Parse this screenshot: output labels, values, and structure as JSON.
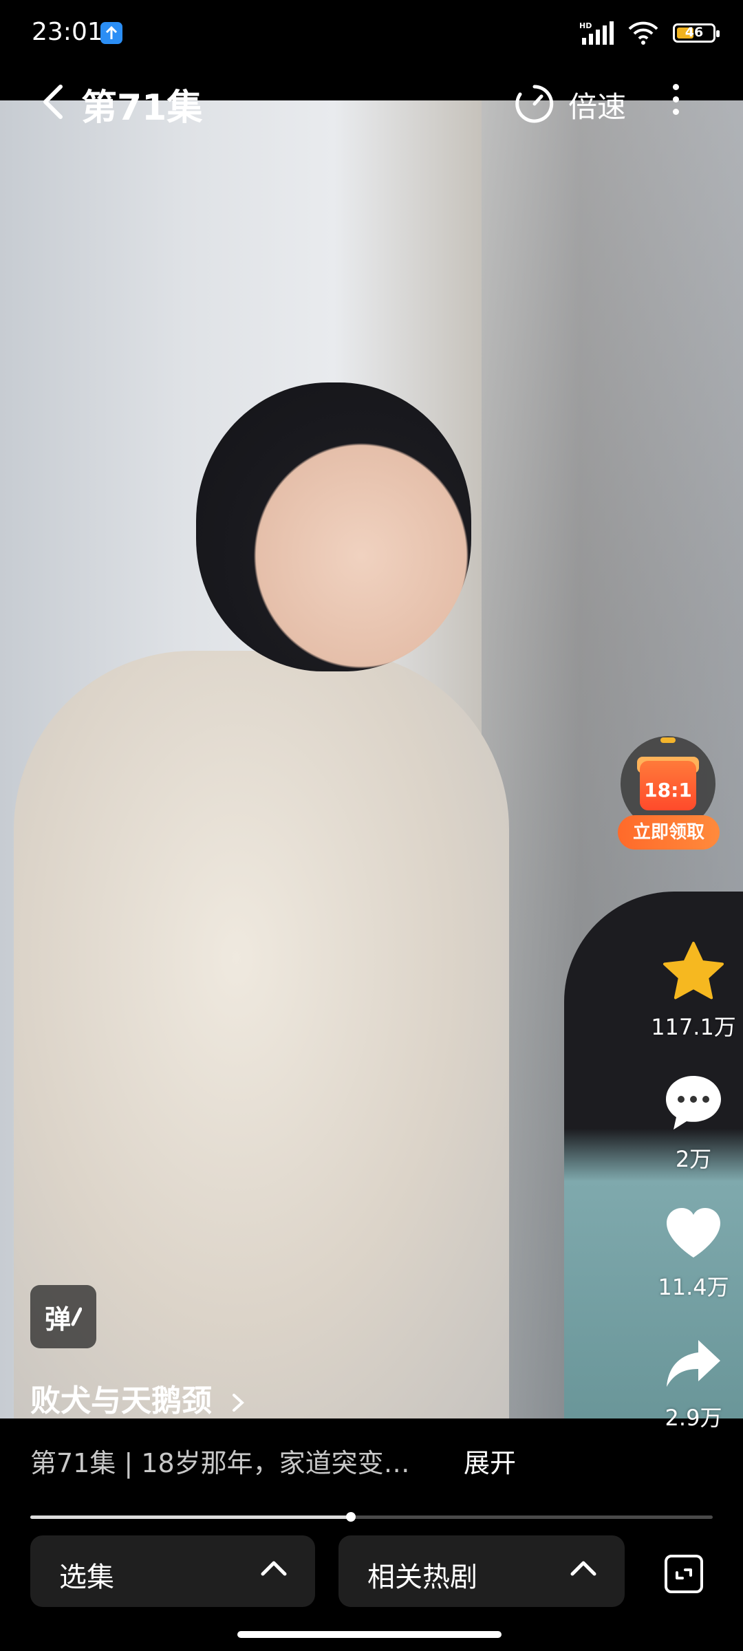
{
  "status_bar": {
    "time": "23:01",
    "hd": "HD",
    "battery": "46"
  },
  "nav": {
    "title": "第71集",
    "speed_label": "倍速"
  },
  "reward": {
    "box_text": "18:1",
    "button_label": "立即领取"
  },
  "actions": {
    "favorite_count": "117.1万",
    "comment_count": "2万",
    "like_count": "11.4万",
    "share_count": "2.9万"
  },
  "danmaku_label": "弹",
  "series_title": "败犬与天鹅颈",
  "description": "第71集 | 18岁那年，家道突变…",
  "expand_label": "展开",
  "progress": {
    "played_fraction": 0.47
  },
  "bottom": {
    "episodes_label": "选集",
    "related_label": "相关热剧"
  },
  "colors": {
    "accent_orange": "#ff6a2a",
    "star_yellow": "#f6b820",
    "upload_blue": "#2b8ef5"
  }
}
